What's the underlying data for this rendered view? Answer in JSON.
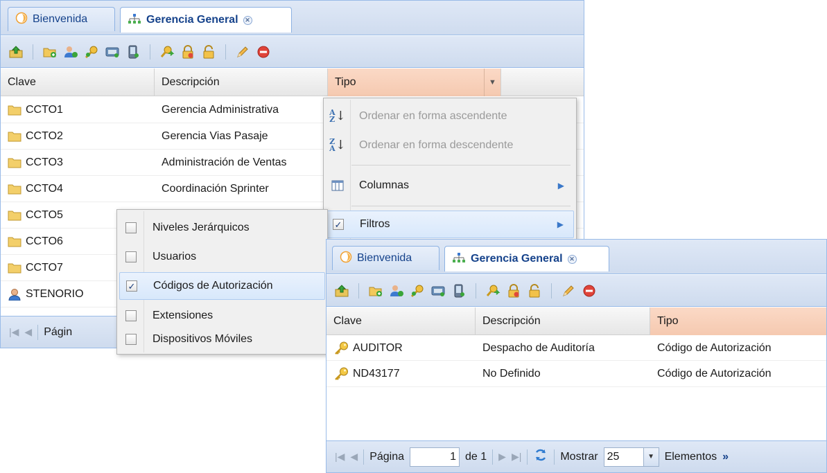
{
  "panel1": {
    "tabs": [
      {
        "label": "Bienvenida",
        "icon": "welcome-icon",
        "active": false
      },
      {
        "label": "Gerencia General",
        "icon": "org-chart-icon",
        "active": true
      }
    ],
    "columns": [
      "Clave",
      "Descripción",
      "Tipo"
    ],
    "rows": [
      {
        "icon": "folder-icon",
        "clave": "CCTO1",
        "descripcion": "Gerencia Administrativa"
      },
      {
        "icon": "folder-icon",
        "clave": "CCTO2",
        "descripcion": "Gerencia Vias Pasaje"
      },
      {
        "icon": "folder-icon",
        "clave": "CCTO3",
        "descripcion": "Administración de Ventas"
      },
      {
        "icon": "folder-icon",
        "clave": "CCTO4",
        "descripcion": "Coordinación Sprinter"
      },
      {
        "icon": "folder-icon",
        "clave": "CCTO5",
        "descripcion": ""
      },
      {
        "icon": "folder-icon",
        "clave": "CCTO6",
        "descripcion": ""
      },
      {
        "icon": "folder-icon",
        "clave": "CCTO7",
        "descripcion": ""
      },
      {
        "icon": "user-icon",
        "clave": "STENORIO",
        "descripcion": ""
      }
    ],
    "paging": {
      "page_label": "Págin"
    }
  },
  "column_menu": {
    "items": [
      {
        "label": "Ordenar en forma ascendente",
        "icon": "sort-ascending-icon",
        "disabled": true
      },
      {
        "label": "Ordenar en forma descendente",
        "icon": "sort-descending-icon",
        "disabled": true
      },
      {
        "label": "Columnas",
        "icon": "columns-icon",
        "submenu": true
      },
      {
        "label": "Filtros",
        "icon": "checkbox-icon",
        "checked": true,
        "submenu": true
      }
    ]
  },
  "filter_menu": {
    "items": [
      {
        "label": "Niveles Jerárquicos",
        "checked": false
      },
      {
        "label": "Usuarios",
        "checked": false
      },
      {
        "label": "Códigos de Autorización",
        "checked": true
      },
      {
        "label": "Extensiones",
        "checked": false
      },
      {
        "label": "Dispositivos Móviles",
        "checked": false
      }
    ]
  },
  "panel2": {
    "tabs": [
      {
        "label": "Bienvenida",
        "icon": "welcome-icon",
        "active": false
      },
      {
        "label": "Gerencia General",
        "icon": "org-chart-icon",
        "active": true
      }
    ],
    "columns": [
      "Clave",
      "Descripción",
      "Tipo"
    ],
    "rows": [
      {
        "icon": "key-icon",
        "clave": "AUDITOR",
        "descripcion": "Despacho de Auditoría",
        "tipo": "Código de Autorización"
      },
      {
        "icon": "key-icon",
        "clave": "ND43177",
        "descripcion": "No Definido",
        "tipo": "Código de Autorización"
      }
    ],
    "paging": {
      "page_label": "Página",
      "page_value": "1",
      "of_label": "de 1",
      "show_label": "Mostrar",
      "page_size": "25",
      "items_label": "Elementos",
      "more": "»"
    }
  },
  "toolbar_icons": [
    "upload-icon",
    "new-folder-icon",
    "add-user-icon",
    "add-key-icon",
    "extension-icon",
    "mobile-device-icon",
    "move-icon",
    "lock-icon",
    "unlock-icon",
    "edit-icon",
    "delete-icon"
  ],
  "colors": {
    "accent_border": "#99bbe8",
    "tab_text": "#15428b",
    "header_highlight": "#f5c9b0"
  }
}
